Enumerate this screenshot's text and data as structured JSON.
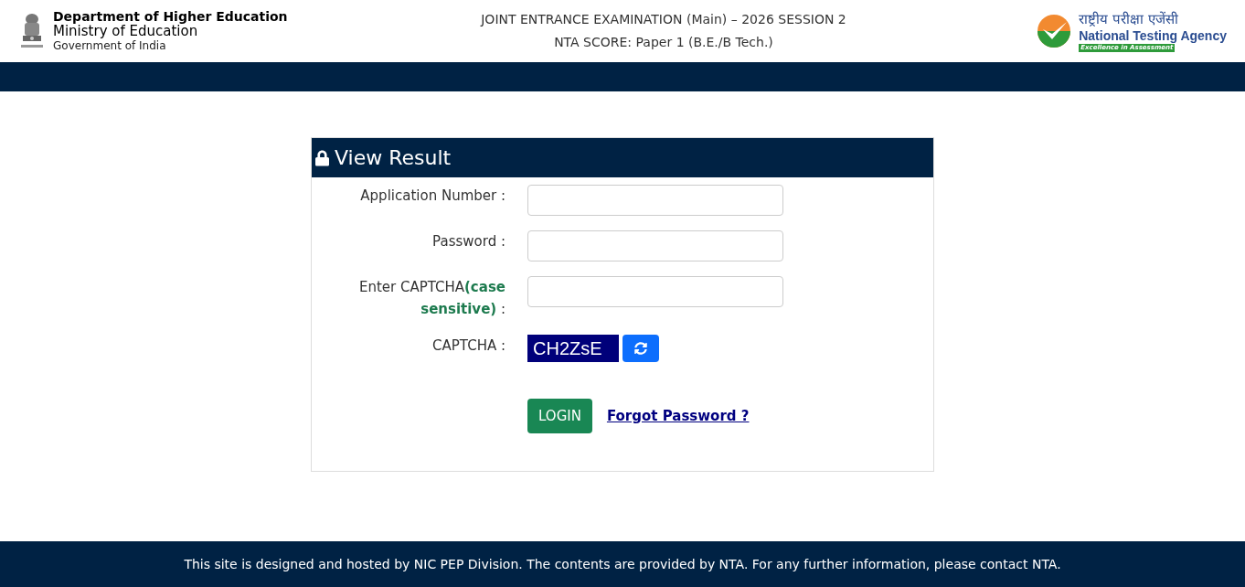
{
  "header": {
    "department": "Department of Higher Education",
    "ministry": "Ministry of Education",
    "government": "Government of India",
    "exam_title": "JOINT ENTRANCE EXAMINATION (Main) – 2026 SESSION 2",
    "exam_subtitle": "NTA SCORE: Paper 1 (B.E./B Tech.)",
    "agency_hindi": "राष्ट्रीय परीक्षा एजेंसी",
    "agency_name": "National Testing Agency",
    "agency_tagline": "Excellence in Assessment"
  },
  "card": {
    "title": "View Result",
    "fields": [
      {
        "kind": "input",
        "label": "Application Number :"
      },
      {
        "kind": "input",
        "label": "Password :"
      },
      {
        "kind": "input",
        "label": "Enter CAPTCHA**(case sensitive)** :"
      },
      {
        "kind": "captcha",
        "label": "CAPTCHA :",
        "value": "CH2ZsE"
      }
    ],
    "login_button": "LOGIN",
    "forgot_link": "Forgot Password ?"
  },
  "footer": "This site is designed and hosted by NIC PEP Division. The contents are provided by NTA. For any further information, please contact NTA."
}
